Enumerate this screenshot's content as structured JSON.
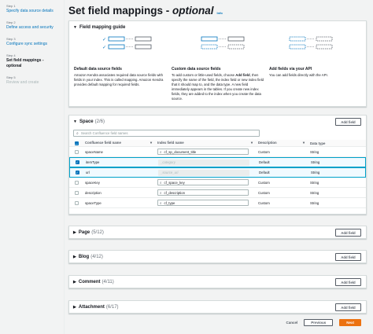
{
  "sidebar": {
    "steps": [
      {
        "num": "Step 1",
        "title": "Specify data source details"
      },
      {
        "num": "Step 2",
        "title": "Define access and security"
      },
      {
        "num": "Step 3",
        "title": "Configure sync settings"
      },
      {
        "num": "Step 4",
        "title": "Set field mappings - optional"
      },
      {
        "num": "Step 5",
        "title": "Review and create"
      }
    ]
  },
  "header": {
    "title": "Set field mappings - ",
    "title_optional": "optional",
    "info": "Info"
  },
  "guide": {
    "heading": "Field mapping guide",
    "cols": [
      {
        "title": "Default data source fields",
        "text": "Amazon Kendra associates required data source fields with fields in your index. This is called mapping. Amazon Kendra provides default mapping for required fields."
      },
      {
        "title": "Custom data source fields",
        "text_pre": "To add custom or little-used fields, choose ",
        "text_bold": "Add field",
        "text_post": ", then specify the name of the field, the index field or new index field that it should map to, and the data type. A new field immediately appears in the tables. If you create new index fields, they are added to the index when you create the data source."
      },
      {
        "title": "Add fields via your API",
        "text": "You can add fields directly with the API."
      }
    ]
  },
  "space": {
    "name": "Space",
    "count": "(2/6)",
    "add_label": "Add field",
    "search_placeholder": "Search Confluence field names",
    "headers": [
      "Confluence field name",
      "Index field name",
      "Description",
      "Data type"
    ],
    "rows": [
      {
        "conf": "spaceName",
        "index": "cf_sp_document_title",
        "desc": "Custom",
        "type": "String",
        "checked": false,
        "disabled": false
      },
      {
        "conf": "itemType",
        "index": "_category",
        "desc": "Default",
        "type": "String",
        "checked": true,
        "disabled": true
      },
      {
        "conf": "url",
        "index": "_source_uri",
        "desc": "Default",
        "type": "String",
        "checked": true,
        "disabled": true
      },
      {
        "conf": "spaceKey",
        "index": "cf_space_key",
        "desc": "Custom",
        "type": "String",
        "checked": false,
        "disabled": false
      },
      {
        "conf": "description",
        "index": "cf_description",
        "desc": "Custom",
        "type": "String",
        "checked": false,
        "disabled": false
      },
      {
        "conf": "spaceType",
        "index": "cf_type",
        "desc": "Custom",
        "type": "String",
        "checked": false,
        "disabled": false
      }
    ]
  },
  "sections": [
    {
      "name": "Page",
      "count": "(5/12)",
      "add_label": "Add field"
    },
    {
      "name": "Blog",
      "count": "(4/12)",
      "add_label": "Add field"
    },
    {
      "name": "Comment",
      "count": "(4/11)",
      "add_label": "Add field"
    },
    {
      "name": "Attachment",
      "count": "(6/17)",
      "add_label": "Add field"
    }
  ],
  "footer": {
    "cancel": "Cancel",
    "previous": "Previous",
    "next": "Next"
  },
  "colors": {
    "accent": "#0073bb",
    "primary_button": "#ec7211",
    "selected_row": "#f1faff",
    "selected_border": "#00a1c9"
  }
}
